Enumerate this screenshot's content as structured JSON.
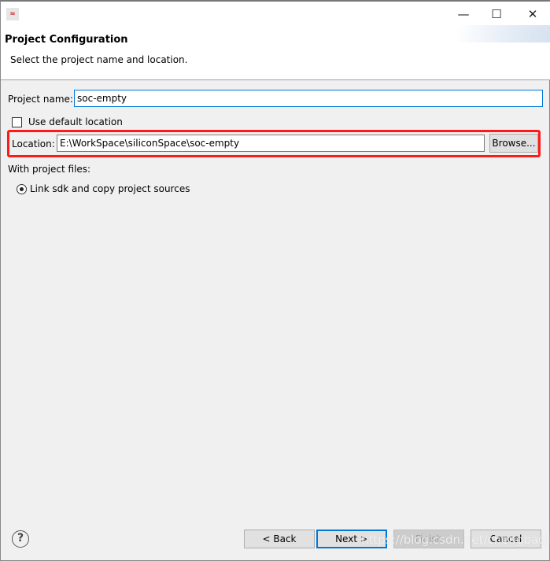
{
  "window": {
    "minimize": "—",
    "maximize": "☐",
    "close": "✕",
    "app_icon": "silicon-labs-icon"
  },
  "header": {
    "title": "Project Configuration",
    "subtitle": "Select the project name and location."
  },
  "form": {
    "project_name_label": "Project name:",
    "project_name_value": "soc-empty",
    "use_default_label": "Use default location",
    "use_default_checked": false,
    "location_label": "Location:",
    "location_value": "E:\\WorkSpace\\siliconSpace\\soc-empty",
    "browse_label": "Browse...",
    "project_files_label": "With project files:",
    "radio_label": "Link sdk and copy project sources",
    "radio_selected": true
  },
  "footer": {
    "help": "?",
    "back": "< Back",
    "next": "Next >",
    "finish": "Finish",
    "cancel": "Cancel"
  },
  "annotation": {
    "highlight_color": "#ff1a1a"
  },
  "watermark": "https://blog.csdn.net/chengbaojin"
}
